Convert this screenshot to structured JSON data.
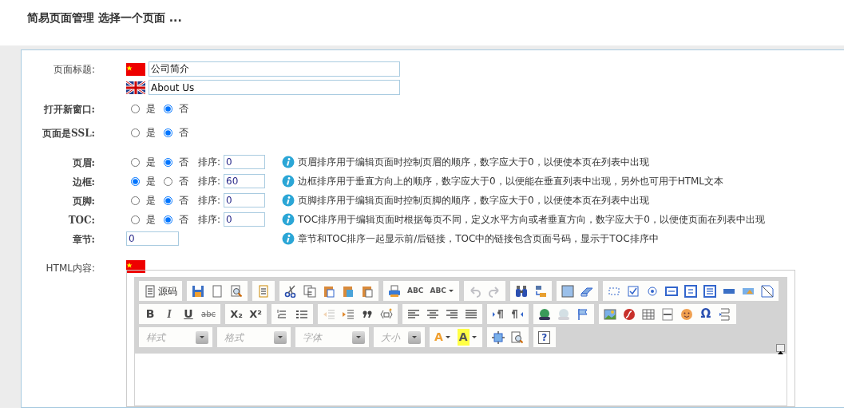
{
  "header": {
    "title": "简易页面管理  选择一个页面  ..."
  },
  "form": [
    {
      "kind": "lang_text",
      "label": "页面标题:",
      "inputs": [
        {
          "flag": {
            "kind": "cn"
          },
          "value": "公司简介"
        },
        {
          "flag": {
            "kind": "en"
          },
          "value": "About Us"
        }
      ]
    },
    {
      "kind": "radio",
      "label": "打开新窗口:",
      "options": [
        {
          "label": "是",
          "selected": false
        },
        {
          "label": "否",
          "selected": true
        }
      ]
    },
    {
      "kind": "radio",
      "label": "页面是SSL:",
      "options": [
        {
          "label": "是",
          "selected": false
        },
        {
          "label": "否",
          "selected": true
        }
      ]
    },
    {
      "kind": "radio_order",
      "label": "页眉:",
      "options": [
        {
          "label": "是",
          "selected": false
        },
        {
          "label": "否",
          "selected": true
        }
      ],
      "order_label": "排序:",
      "order": "0",
      "help": "页眉排序用于编辑页面时控制页眉的顺序，数字应大于0，以便使本页在列表中出现"
    },
    {
      "kind": "radio_order",
      "label": "边框:",
      "options": [
        {
          "label": "是",
          "selected": true
        },
        {
          "label": "否",
          "selected": false
        }
      ],
      "order_label": "排序:",
      "order": "60",
      "help": "边框排序用于垂直方向上的顺序，数字应大于0，以便能在垂直列表中出现，另外也可用于HTML文本"
    },
    {
      "kind": "radio_order",
      "label": "页脚:",
      "options": [
        {
          "label": "是",
          "selected": false
        },
        {
          "label": "否",
          "selected": true
        }
      ],
      "order_label": "排序:",
      "order": "0",
      "help": "页脚排序用于编辑页面时控制页脚的顺序，数字应大于0，以便使本页在列表中出现"
    },
    {
      "kind": "radio_order",
      "label": "TOC:",
      "options": [
        {
          "label": "是",
          "selected": false
        },
        {
          "label": "否",
          "selected": true
        }
      ],
      "order_label": "排序:",
      "order": "0",
      "help": "TOC排序用于编辑页面时根据每页不同，定义水平方向或者垂直方向，数字应大于0，以便使页面在列表中出现"
    },
    {
      "kind": "number",
      "label": "章节:",
      "value": "0",
      "help": "章节和TOC排序一起显示前/后链接，TOC中的链接包含页面号码，显示于TOC排序中"
    },
    {
      "kind": "editor",
      "label": "HTML内容:",
      "flag": {
        "kind": "cn"
      },
      "toolbar": [
        [
          [
            {
              "kind": "source",
              "label": "源码",
              "disabled": false
            }
          ],
          [
            {
              "kind": "save",
              "disabled": false
            },
            {
              "kind": "newpage",
              "disabled": false
            },
            {
              "kind": "preview",
              "disabled": false
            }
          ],
          [
            {
              "kind": "template",
              "disabled": false
            }
          ],
          [
            {
              "kind": "cut",
              "disabled": false
            },
            {
              "kind": "copy",
              "disabled": false
            },
            {
              "kind": "paste",
              "disabled": false
            },
            {
              "kind": "pastetext",
              "disabled": false
            },
            {
              "kind": "pasteword",
              "disabled": false
            }
          ],
          [
            {
              "kind": "print",
              "disabled": false
            },
            {
              "kind": "spell",
              "glyph": "ABC",
              "disabled": false
            },
            {
              "kind": "spellmenu",
              "glyph": "ABC",
              "disabled": false
            }
          ],
          [
            {
              "kind": "undo",
              "disabled": true
            },
            {
              "kind": "redo",
              "disabled": true
            }
          ],
          [
            {
              "kind": "find",
              "disabled": false
            },
            {
              "kind": "replace",
              "disabled": false
            }
          ],
          [
            {
              "kind": "selectall",
              "disabled": false
            },
            {
              "kind": "eraser",
              "disabled": false
            }
          ],
          [
            {
              "kind": "form",
              "disabled": false
            },
            {
              "kind": "checkbox",
              "disabled": false
            },
            {
              "kind": "radio",
              "disabled": false
            },
            {
              "kind": "textfield",
              "disabled": false
            },
            {
              "kind": "textarea",
              "disabled": false
            },
            {
              "kind": "select",
              "disabled": false
            },
            {
              "kind": "button",
              "disabled": false
            },
            {
              "kind": "imagebutton",
              "disabled": false
            },
            {
              "kind": "hidden",
              "disabled": false
            }
          ]
        ],
        [
          [
            {
              "kind": "bold",
              "glyph": "B",
              "disabled": false
            },
            {
              "kind": "italic",
              "glyph": "I",
              "disabled": false
            },
            {
              "kind": "underline",
              "glyph": "U",
              "disabled": false
            },
            {
              "kind": "strike",
              "glyph": "abc",
              "disabled": false
            }
          ],
          [
            {
              "kind": "sub",
              "glyph": "X₂",
              "disabled": false
            },
            {
              "kind": "sup",
              "glyph": "X²",
              "disabled": false
            }
          ],
          [
            {
              "kind": "ol",
              "disabled": false
            },
            {
              "kind": "ul",
              "disabled": false
            }
          ],
          [
            {
              "kind": "outdent",
              "disabled": true
            },
            {
              "kind": "indent",
              "disabled": false
            },
            {
              "kind": "quote",
              "disabled": false
            },
            {
              "kind": "div",
              "disabled": false
            }
          ],
          [
            {
              "kind": "left",
              "disabled": false
            },
            {
              "kind": "center",
              "disabled": false
            },
            {
              "kind": "right",
              "disabled": false
            },
            {
              "kind": "justify",
              "disabled": false
            }
          ],
          [
            {
              "kind": "ltr",
              "disabled": false
            },
            {
              "kind": "rtl",
              "disabled": false
            }
          ],
          [
            {
              "kind": "link",
              "disabled": false
            },
            {
              "kind": "unlink",
              "disabled": true
            },
            {
              "kind": "anchor",
              "disabled": false
            }
          ],
          [
            {
              "kind": "image",
              "disabled": false
            },
            {
              "kind": "flash",
              "disabled": false
            },
            {
              "kind": "table",
              "disabled": false
            },
            {
              "kind": "hr",
              "disabled": false
            },
            {
              "kind": "smiley",
              "disabled": false
            },
            {
              "kind": "special",
              "glyph": "Ω",
              "disabled": false
            },
            {
              "kind": "pagebreak",
              "disabled": false
            }
          ]
        ],
        [
          [
            {
              "kind": "combo",
              "placeholder": "样式",
              "disabled": false
            }
          ],
          [
            {
              "kind": "combo",
              "placeholder": "格式",
              "disabled": false
            }
          ],
          [
            {
              "kind": "combo",
              "placeholder": "字体",
              "disabled": false
            }
          ],
          [
            {
              "kind": "combo_small",
              "placeholder": "大小",
              "disabled": false
            }
          ],
          [
            {
              "kind": "textcolor",
              "glyph": "A",
              "disabled": false
            },
            {
              "kind": "bgcolor",
              "glyph": "A",
              "disabled": false
            }
          ],
          [
            {
              "kind": "maximize",
              "disabled": false
            },
            {
              "kind": "showblocks",
              "disabled": false
            }
          ],
          [
            {
              "kind": "about",
              "glyph": "?",
              "disabled": false
            }
          ]
        ]
      ]
    }
  ]
}
